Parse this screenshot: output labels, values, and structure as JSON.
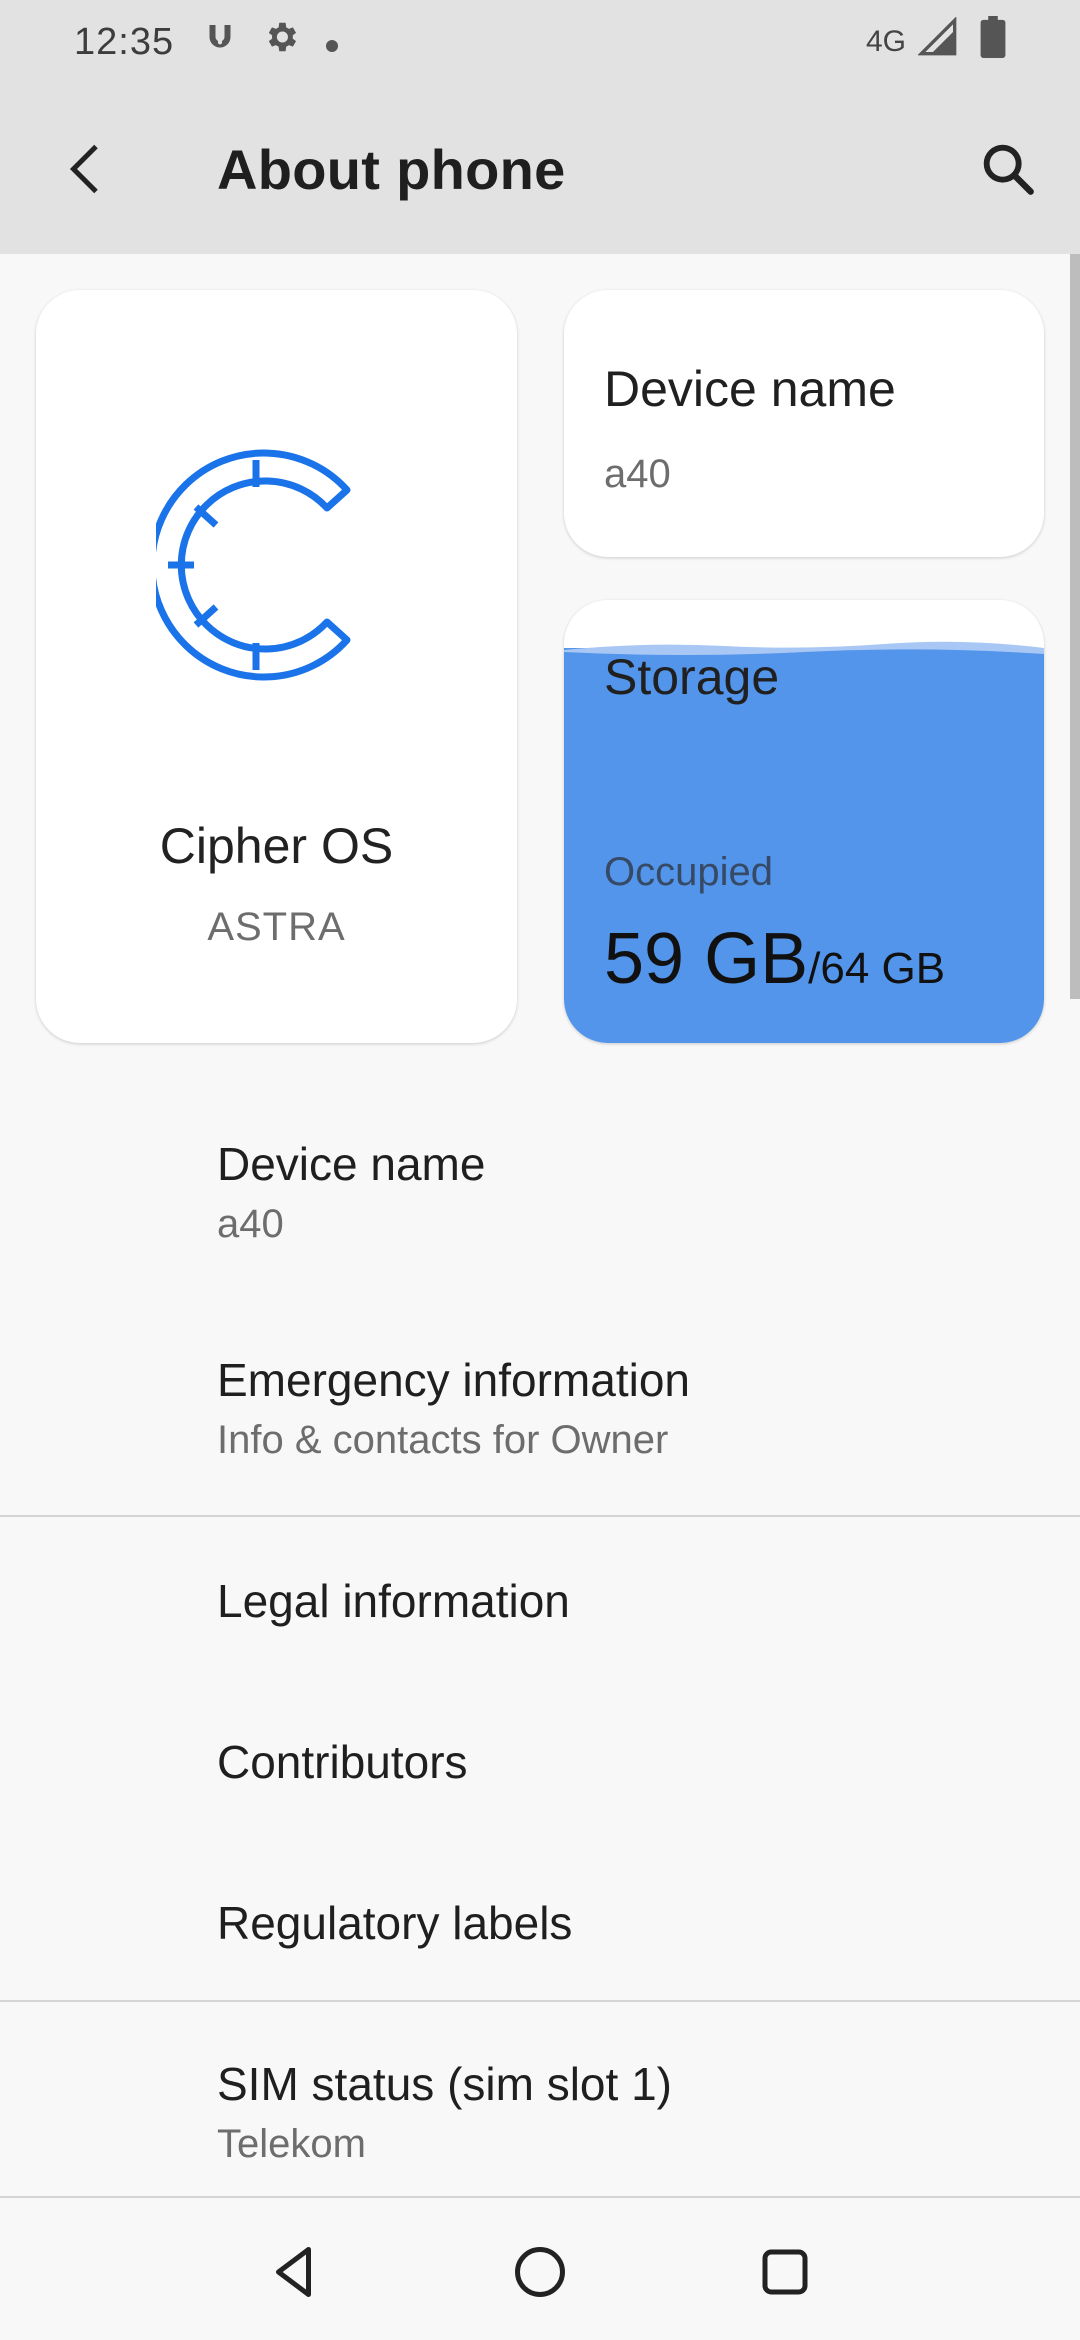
{
  "status_bar": {
    "time": "12:35",
    "network": "4G",
    "icons": [
      "vpn-key-icon",
      "settings-gear-icon",
      "notification-dot-icon",
      "signal-icon",
      "battery-icon"
    ]
  },
  "app_bar": {
    "title": "About phone",
    "back_icon": "arrow-back-icon",
    "search_icon": "search-icon"
  },
  "cards": {
    "os": {
      "name": "Cipher OS",
      "version": "ASTRA",
      "logo_icon": "cipher-os-logo-icon",
      "logo_color": "#1a73e8"
    },
    "device": {
      "title": "Device name",
      "value": "a40"
    },
    "storage": {
      "title": "Storage",
      "occupied_label": "Occupied",
      "used": "59 GB",
      "total": "/64 GB",
      "fill_fraction": 0.92,
      "fill_color": "#5395ea"
    }
  },
  "list": {
    "items": [
      {
        "title": "Device name",
        "subtitle": "a40"
      },
      {
        "title": "Emergency information",
        "subtitle": "Info & contacts for Owner"
      },
      {
        "title": "Legal information",
        "subtitle": ""
      },
      {
        "title": "Contributors",
        "subtitle": ""
      },
      {
        "title": "Regulatory labels",
        "subtitle": ""
      },
      {
        "title": "SIM status (sim slot 1)",
        "subtitle": "Telekom"
      }
    ]
  },
  "nav_bar": {
    "icons": [
      "nav-back-icon",
      "nav-home-icon",
      "nav-recents-icon"
    ]
  }
}
